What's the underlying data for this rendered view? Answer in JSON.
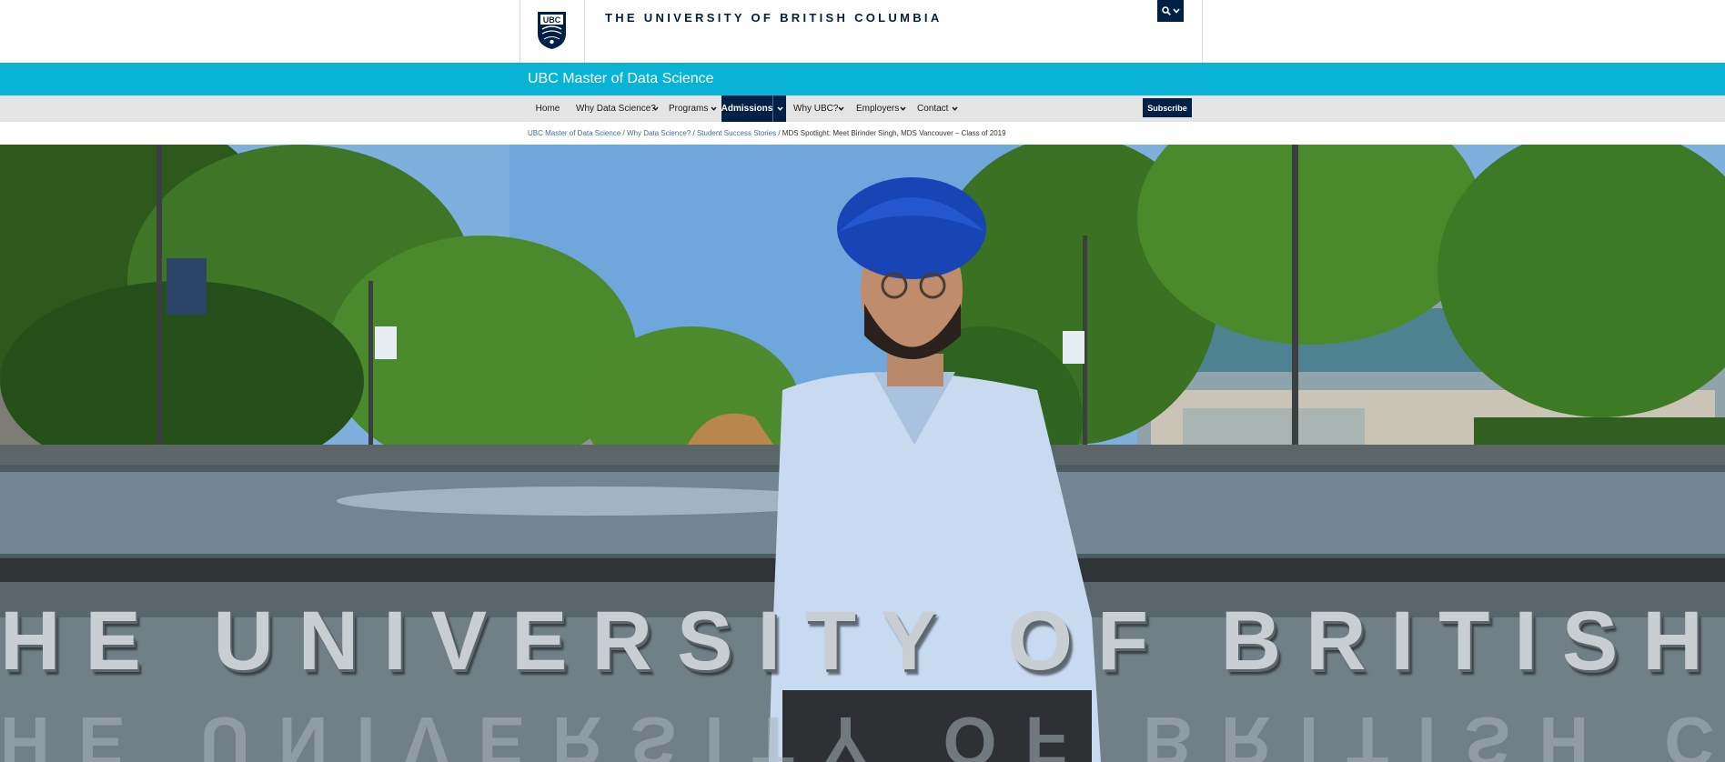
{
  "header": {
    "crest_text": "UBC",
    "wordmark": "THE UNIVERSITY OF BRITISH COLUMBIA",
    "search_icon": "search-icon",
    "search_dropdown_icon": "chevron-down-icon"
  },
  "unit": {
    "title": "UBC Master of Data Science"
  },
  "nav": {
    "items": [
      {
        "label": "Home",
        "has_dropdown": false,
        "active": false
      },
      {
        "label": "Why Data Science?",
        "has_dropdown": true,
        "active": false
      },
      {
        "label": "Programs",
        "has_dropdown": true,
        "active": false
      },
      {
        "label": "Admissions",
        "has_dropdown": true,
        "active": true
      },
      {
        "label": "Why UBC?",
        "has_dropdown": true,
        "active": false
      },
      {
        "label": "Employers",
        "has_dropdown": true,
        "active": false
      },
      {
        "label": "Contact",
        "has_dropdown": true,
        "active": false
      }
    ],
    "subscribe_label": "Subscribe"
  },
  "breadcrumb": {
    "items": [
      {
        "label": "UBC Master of Data Science",
        "link": true
      },
      {
        "label": "Why Data Science?",
        "link": true
      },
      {
        "label": "Student Success Stories",
        "link": true
      },
      {
        "label": "MDS Spotlight: Meet Birinder Singh, MDS Vancouver – Class of 2019",
        "link": false
      }
    ],
    "separator": "/"
  },
  "hero": {
    "sculpture_text": "HE UNIVERSITY OF BRITISH C",
    "sculpture_reflection": "HE UNIVERSITY OF BRITISH C"
  },
  "colors": {
    "ubc_blue": "#002145",
    "unit_bar": "#09b3d6",
    "nav_background": "#e4e4e4"
  }
}
